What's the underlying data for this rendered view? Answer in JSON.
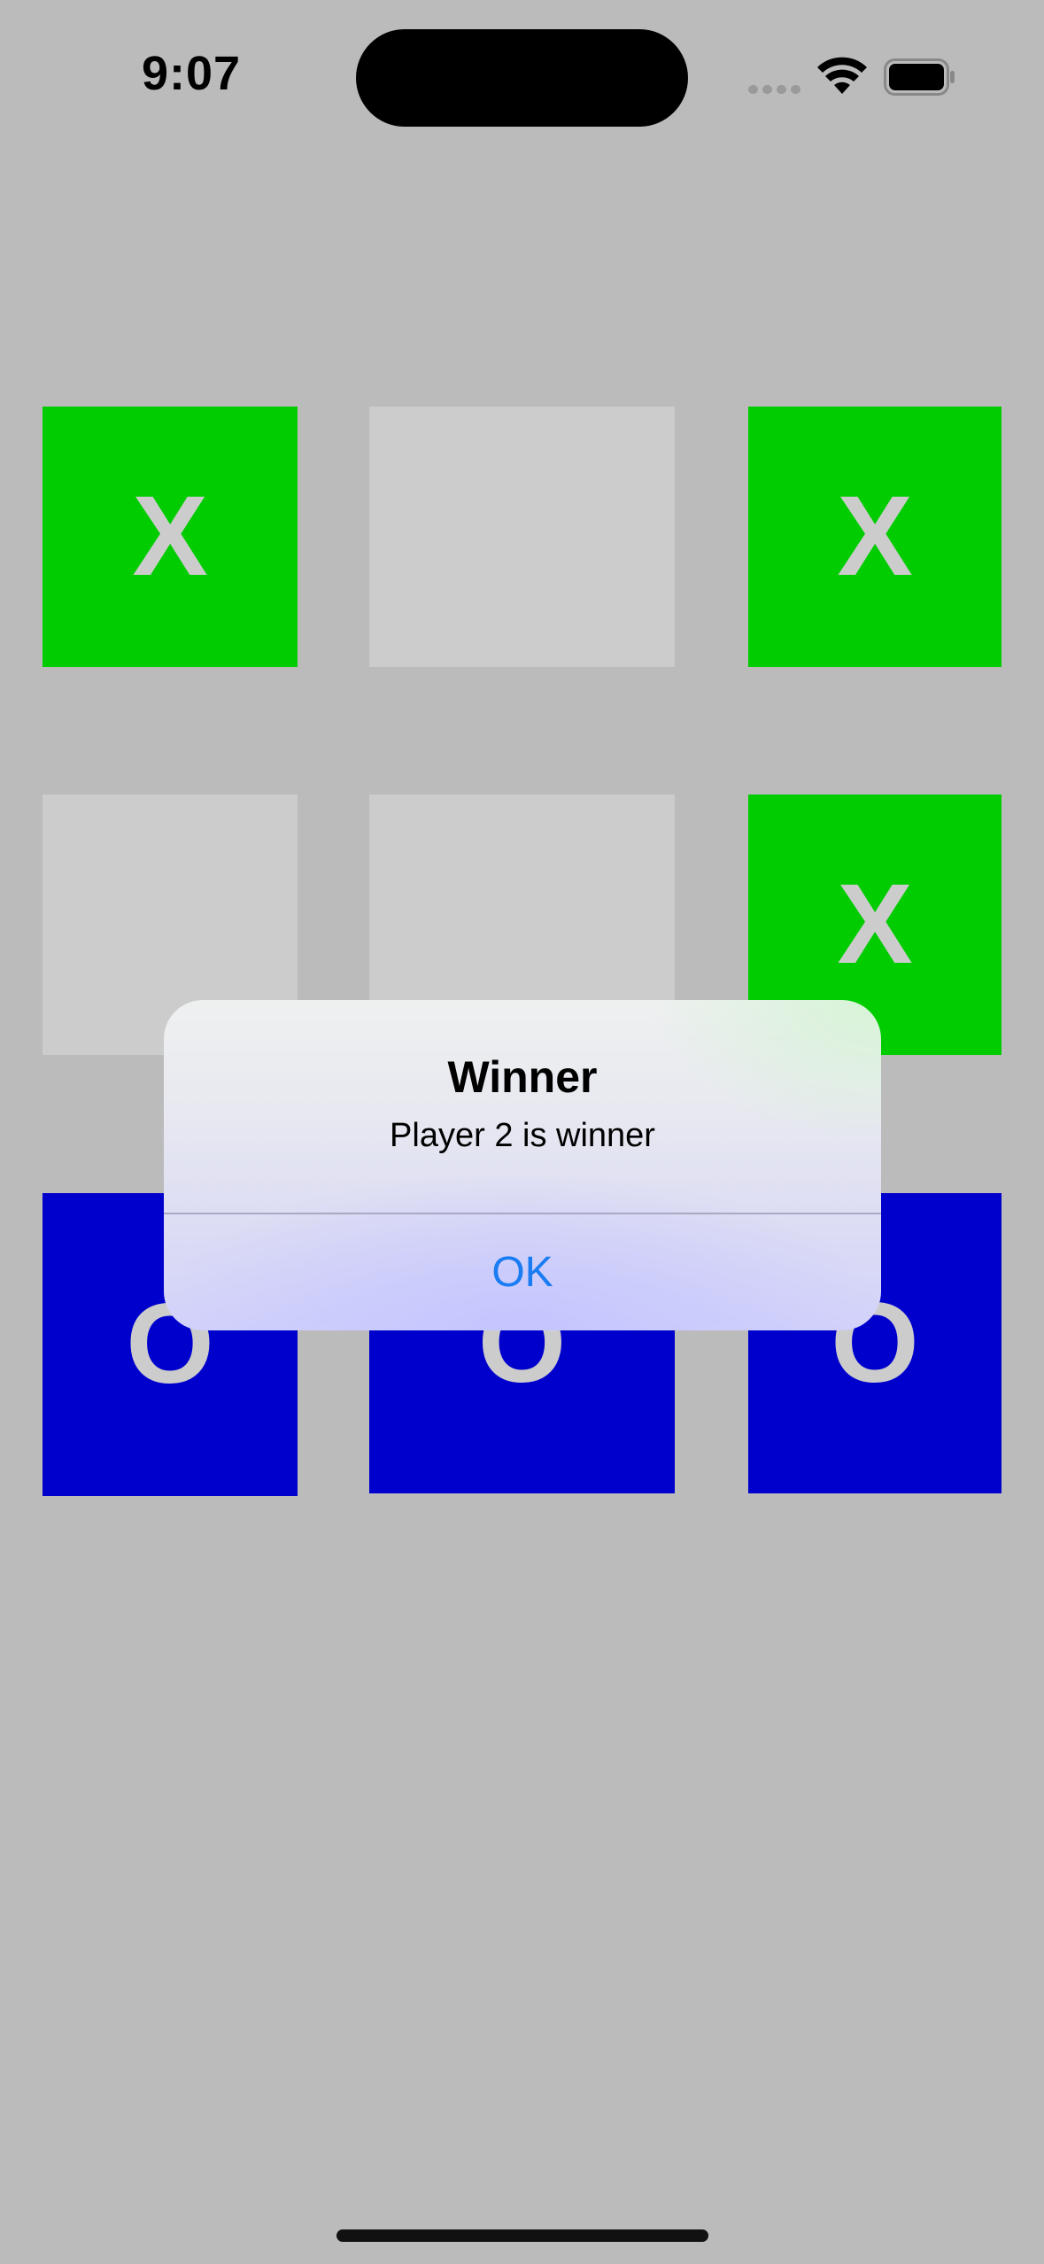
{
  "status_bar": {
    "time": "9:07",
    "signal_icon": "cellular-signal-icon",
    "wifi_icon": "wifi-icon",
    "battery_icon": "battery-icon"
  },
  "board": {
    "rows": [
      [
        "X",
        "",
        "X"
      ],
      [
        "",
        "",
        "X"
      ],
      [
        "O",
        "O",
        "O"
      ]
    ],
    "colors": {
      "empty": "#cccccc",
      "x": "#00cc00",
      "o": "#0000cc",
      "mark": "#cccccc"
    }
  },
  "alert": {
    "title": "Winner",
    "message": "Player 2 is winner",
    "ok_label": "OK",
    "ok_color": "#1a7cf2"
  },
  "background": "#bbbbbb"
}
